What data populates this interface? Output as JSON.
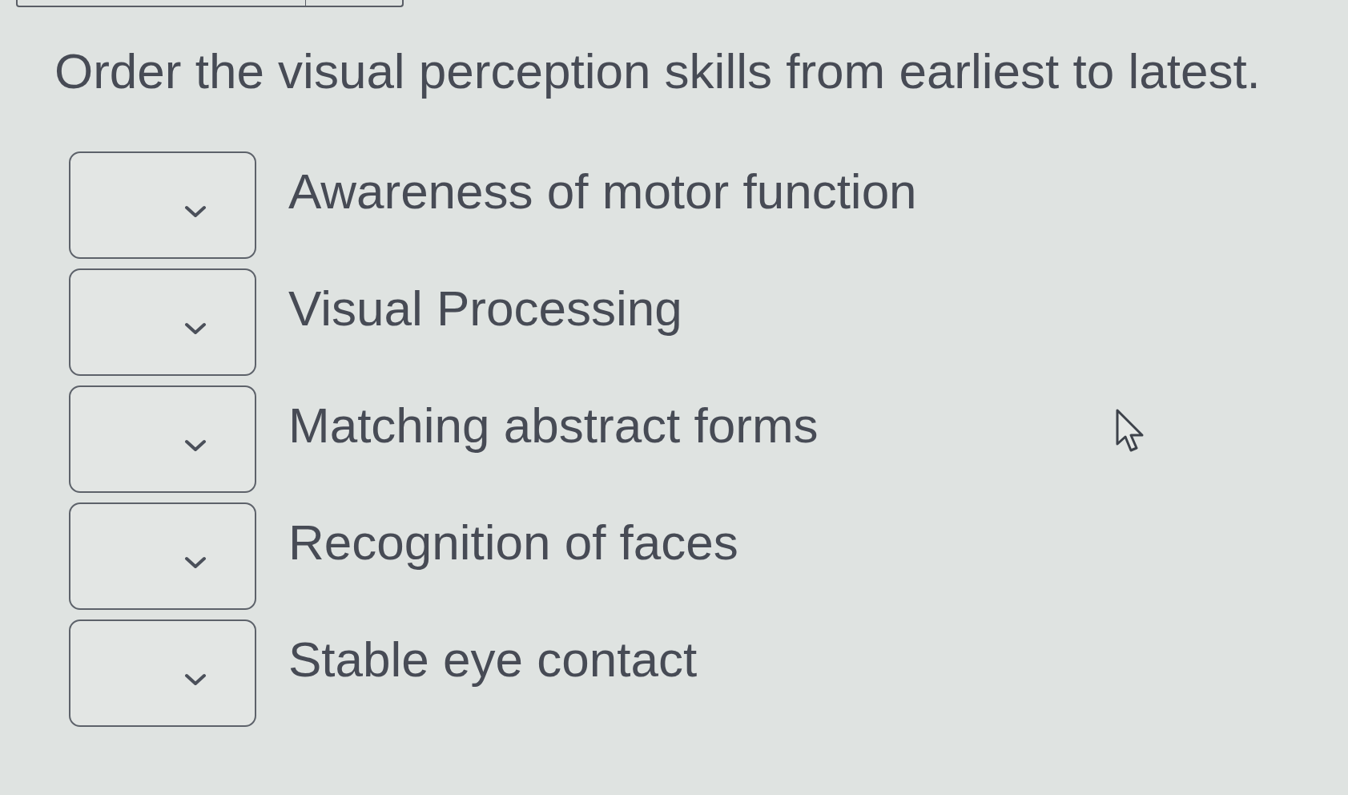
{
  "prompt": "Order the visual perception skills from earliest to latest.",
  "items": [
    {
      "label": "Awareness of motor function"
    },
    {
      "label": "Visual Processing"
    },
    {
      "label": "Matching abstract forms"
    },
    {
      "label": "Recognition of faces"
    },
    {
      "label": "Stable eye contact"
    }
  ]
}
